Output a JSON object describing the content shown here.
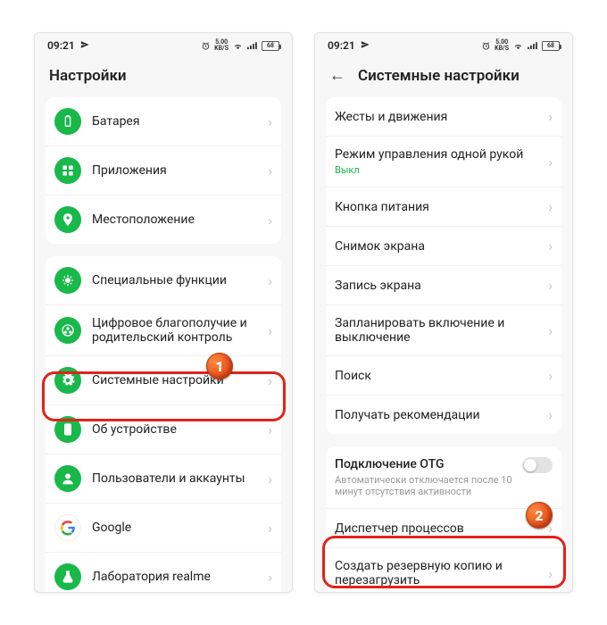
{
  "status": {
    "time": "09:21",
    "speed_top": "5.00",
    "speed_bot": "KB/S",
    "battery": "68"
  },
  "left": {
    "title": "Настройки",
    "groups": [
      {
        "items": [
          {
            "icon": "battery-icon",
            "label": "Батарея"
          },
          {
            "icon": "apps-icon",
            "label": "Приложения"
          },
          {
            "icon": "location-icon",
            "label": "Местоположение"
          }
        ]
      },
      {
        "items": [
          {
            "icon": "star-icon",
            "label": "Специальные функции"
          },
          {
            "icon": "wellbeing-icon",
            "label": "Цифровое благополучие и родительский контроль"
          },
          {
            "icon": "gear-icon",
            "label": "Системные настройки"
          },
          {
            "icon": "phone-icon",
            "label": "Об устройстве"
          },
          {
            "icon": "users-icon",
            "label": "Пользователи и аккаунты"
          },
          {
            "icon": "google-icon",
            "label": "Google"
          },
          {
            "icon": "flask-icon",
            "label": "Лаборатория realme"
          }
        ]
      }
    ]
  },
  "right": {
    "title": "Системные настройки",
    "groups": [
      {
        "items": [
          {
            "label": "Жесты и движения"
          },
          {
            "label": "Режим управления одной рукой",
            "sub": "Выкл",
            "subColor": "green"
          },
          {
            "label": "Кнопка питания"
          },
          {
            "label": "Снимок экрана"
          },
          {
            "label": "Запись экрана"
          },
          {
            "label": "Запланировать включение и выключение"
          },
          {
            "label": "Поиск"
          },
          {
            "label": "Получать рекомендации"
          }
        ]
      },
      {
        "otg": {
          "title": "Подключение OTG",
          "sub": "Автоматически отключается после 10 минут отсутствия активности"
        },
        "items": [
          {
            "label": "Диспетчер процессов"
          },
          {
            "label": "Создать резервную копию и перезагрузить"
          }
        ]
      }
    ]
  },
  "badges": {
    "one": "1",
    "two": "2"
  }
}
